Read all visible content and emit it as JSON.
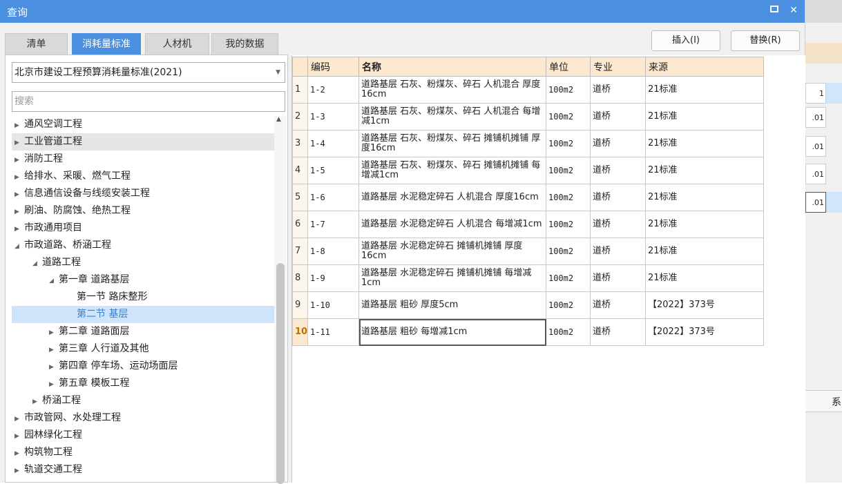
{
  "window": {
    "title": "查询",
    "restore_icon": "restore-icon",
    "close_label": "✕"
  },
  "tabs": [
    {
      "label": "清单",
      "active": false
    },
    {
      "label": "消耗量标准",
      "active": true
    },
    {
      "label": "人材机",
      "active": false
    },
    {
      "label": "我的数据",
      "active": false
    }
  ],
  "buttons": {
    "insert": "插入(I)",
    "replace": "替换(R)"
  },
  "left": {
    "selected_standard": "北京市建设工程预算消耗量标准(2021)",
    "search_placeholder": "搜索",
    "tree": [
      {
        "label": "通风空调工程",
        "state": "collapsed"
      },
      {
        "label": "工业管道工程",
        "state": "collapsed"
      },
      {
        "label": "消防工程",
        "state": "collapsed"
      },
      {
        "label": "给排水、采暖、燃气工程",
        "state": "collapsed"
      },
      {
        "label": "信息通信设备与线缆安装工程",
        "state": "collapsed"
      },
      {
        "label": "刷油、防腐蚀、绝热工程",
        "state": "collapsed"
      },
      {
        "label": "市政通用项目",
        "state": "collapsed"
      },
      {
        "label": "市政道路、桥涵工程",
        "state": "expanded"
      },
      {
        "label": "道路工程",
        "state": "expanded"
      },
      {
        "label": "第一章 道路基层",
        "state": "expanded"
      },
      {
        "label": "第一节 路床整形",
        "state": "leaf"
      },
      {
        "label": "第二节 基层",
        "state": "leaf-selected"
      },
      {
        "label": "第二章 道路面层",
        "state": "collapsed"
      },
      {
        "label": "第三章 人行道及其他",
        "state": "collapsed"
      },
      {
        "label": "第四章 停车场、运动场面层",
        "state": "collapsed"
      },
      {
        "label": "第五章 模板工程",
        "state": "collapsed"
      },
      {
        "label": "桥涵工程",
        "state": "collapsed"
      },
      {
        "label": "市政管网、水处理工程",
        "state": "collapsed"
      },
      {
        "label": "园林绿化工程",
        "state": "collapsed"
      },
      {
        "label": "构筑物工程",
        "state": "collapsed"
      },
      {
        "label": "轨道交通工程",
        "state": "collapsed"
      }
    ]
  },
  "grid": {
    "headers": [
      "编码",
      "名称",
      "单位",
      "专业",
      "来源"
    ],
    "rows": [
      {
        "n": "1",
        "code": "1-2",
        "name": "道路基层 石灰、粉煤灰、碎石 人机混合 厚度16cm",
        "unit": "100m2",
        "spec": "道桥",
        "src": "21标准"
      },
      {
        "n": "2",
        "code": "1-3",
        "name": "道路基层 石灰、粉煤灰、碎石 人机混合 每增减1cm",
        "unit": "100m2",
        "spec": "道桥",
        "src": "21标准"
      },
      {
        "n": "3",
        "code": "1-4",
        "name": "道路基层 石灰、粉煤灰、碎石 摊铺机摊铺 厚度16cm",
        "unit": "100m2",
        "spec": "道桥",
        "src": "21标准"
      },
      {
        "n": "4",
        "code": "1-5",
        "name": "道路基层 石灰、粉煤灰、碎石 摊铺机摊铺 每增减1cm",
        "unit": "100m2",
        "spec": "道桥",
        "src": "21标准"
      },
      {
        "n": "5",
        "code": "1-6",
        "name": "道路基层 水泥稳定碎石 人机混合 厚度16cm",
        "unit": "100m2",
        "spec": "道桥",
        "src": "21标准"
      },
      {
        "n": "6",
        "code": "1-7",
        "name": "道路基层 水泥稳定碎石 人机混合 每增减1cm",
        "unit": "100m2",
        "spec": "道桥",
        "src": "21标准"
      },
      {
        "n": "7",
        "code": "1-8",
        "name": "道路基层 水泥稳定碎石 摊铺机摊铺 厚度16cm",
        "unit": "100m2",
        "spec": "道桥",
        "src": "21标准"
      },
      {
        "n": "8",
        "code": "1-9",
        "name": "道路基层 水泥稳定碎石 摊铺机摊铺 每增减1cm",
        "unit": "100m2",
        "spec": "道桥",
        "src": "21标准"
      },
      {
        "n": "9",
        "code": "1-10",
        "name": "道路基层 粗砂 厚度5cm",
        "unit": "100m2",
        "spec": "道桥",
        "src": "【2022】373号"
      },
      {
        "n": "10",
        "code": "1-11",
        "name": "道路基层 粗砂 每增减1cm",
        "unit": "100m2",
        "spec": "道桥",
        "src": "【2022】373号"
      }
    ]
  },
  "background_cells": [
    "1",
    ".01",
    ".01",
    ".01",
    ".01"
  ],
  "background_header_char": "系"
}
